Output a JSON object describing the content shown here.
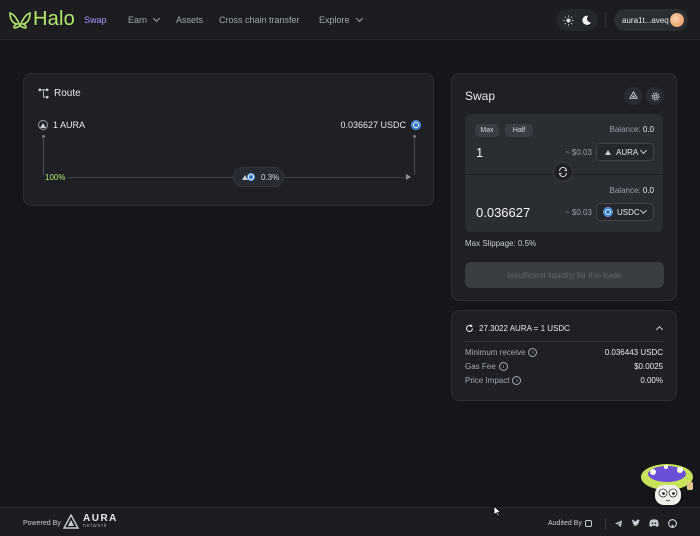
{
  "header": {
    "brand": "Halo",
    "nav": [
      {
        "label": "Swap",
        "active": true
      },
      {
        "label": "Earn",
        "dropdown": true
      },
      {
        "label": "Assets"
      },
      {
        "label": "Cross chain transfer"
      },
      {
        "label": "Explore",
        "dropdown": true
      }
    ],
    "theme_icons": [
      "sun-icon",
      "moon-icon"
    ],
    "wallet_address": "aura1t...aveq"
  },
  "route": {
    "title": "Route",
    "from": {
      "amount_label": "1 AURA",
      "icon": "aura-token-icon"
    },
    "to": {
      "amount_label": "0.036627 USDC",
      "icon": "usdc-token-icon"
    },
    "split_percent": "100%",
    "pool_fee": "0.3%"
  },
  "swap": {
    "title": "Swap",
    "max_label": "Max",
    "half_label": "Half",
    "from": {
      "balance_label": "Balance:",
      "balance": "0.0",
      "amount": "1",
      "usd": "~ $0.03",
      "token": "AURA"
    },
    "to": {
      "balance_label": "Balance:",
      "balance": "0.0",
      "amount": "0.036627",
      "usd": "~ $0.03",
      "token": "USDC"
    },
    "max_slippage": "Max Slippage: 0.5%",
    "cta": "Insufficient liquidity for this trade"
  },
  "details": {
    "rate": "27.3022 AURA = 1 USDC",
    "rows": [
      {
        "label": "Minimum receive",
        "value": "0.036443 USDC",
        "info": true
      },
      {
        "label": "Gas Fee",
        "value": "$0.0025",
        "info": true
      },
      {
        "label": "Price Impact",
        "value": "0.00%",
        "info": true
      }
    ]
  },
  "footer": {
    "powered_by": "Powered By",
    "brand_name": "AURA",
    "brand_sub": "network",
    "audited_by": "Audited By",
    "socials": [
      "telegram-icon",
      "twitter-icon",
      "discord-icon",
      "github-icon"
    ]
  },
  "colors": {
    "accent_green": "#b4e86a",
    "accent_purple": "#a99bff",
    "usdc_blue": "#2775ca",
    "background": "#141619",
    "card": "#1e2025"
  }
}
